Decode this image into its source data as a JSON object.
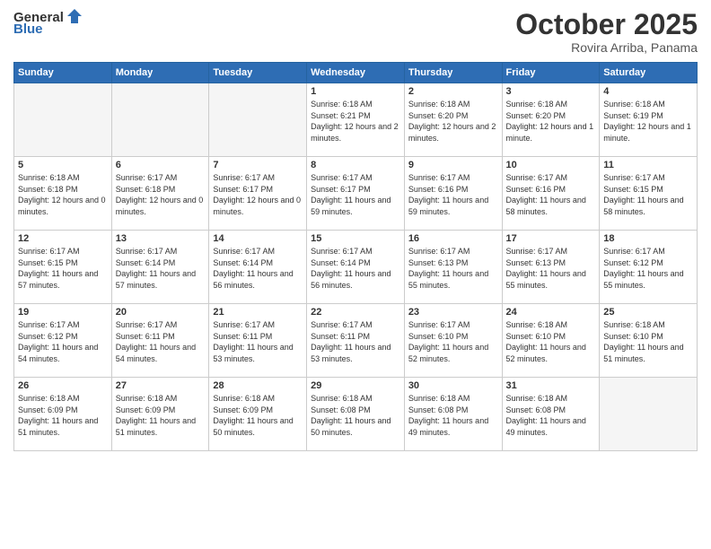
{
  "header": {
    "logo_general": "General",
    "logo_blue": "Blue",
    "month_title": "October 2025",
    "location": "Rovira Arriba, Panama"
  },
  "weekdays": [
    "Sunday",
    "Monday",
    "Tuesday",
    "Wednesday",
    "Thursday",
    "Friday",
    "Saturday"
  ],
  "weeks": [
    [
      {
        "day": "",
        "empty": true
      },
      {
        "day": "",
        "empty": true
      },
      {
        "day": "",
        "empty": true
      },
      {
        "day": "1",
        "sunrise": "Sunrise: 6:18 AM",
        "sunset": "Sunset: 6:21 PM",
        "daylight": "Daylight: 12 hours and 2 minutes."
      },
      {
        "day": "2",
        "sunrise": "Sunrise: 6:18 AM",
        "sunset": "Sunset: 6:20 PM",
        "daylight": "Daylight: 12 hours and 2 minutes."
      },
      {
        "day": "3",
        "sunrise": "Sunrise: 6:18 AM",
        "sunset": "Sunset: 6:20 PM",
        "daylight": "Daylight: 12 hours and 1 minute."
      },
      {
        "day": "4",
        "sunrise": "Sunrise: 6:18 AM",
        "sunset": "Sunset: 6:19 PM",
        "daylight": "Daylight: 12 hours and 1 minute."
      }
    ],
    [
      {
        "day": "5",
        "sunrise": "Sunrise: 6:18 AM",
        "sunset": "Sunset: 6:18 PM",
        "daylight": "Daylight: 12 hours and 0 minutes."
      },
      {
        "day": "6",
        "sunrise": "Sunrise: 6:17 AM",
        "sunset": "Sunset: 6:18 PM",
        "daylight": "Daylight: 12 hours and 0 minutes."
      },
      {
        "day": "7",
        "sunrise": "Sunrise: 6:17 AM",
        "sunset": "Sunset: 6:17 PM",
        "daylight": "Daylight: 12 hours and 0 minutes."
      },
      {
        "day": "8",
        "sunrise": "Sunrise: 6:17 AM",
        "sunset": "Sunset: 6:17 PM",
        "daylight": "Daylight: 11 hours and 59 minutes."
      },
      {
        "day": "9",
        "sunrise": "Sunrise: 6:17 AM",
        "sunset": "Sunset: 6:16 PM",
        "daylight": "Daylight: 11 hours and 59 minutes."
      },
      {
        "day": "10",
        "sunrise": "Sunrise: 6:17 AM",
        "sunset": "Sunset: 6:16 PM",
        "daylight": "Daylight: 11 hours and 58 minutes."
      },
      {
        "day": "11",
        "sunrise": "Sunrise: 6:17 AM",
        "sunset": "Sunset: 6:15 PM",
        "daylight": "Daylight: 11 hours and 58 minutes."
      }
    ],
    [
      {
        "day": "12",
        "sunrise": "Sunrise: 6:17 AM",
        "sunset": "Sunset: 6:15 PM",
        "daylight": "Daylight: 11 hours and 57 minutes."
      },
      {
        "day": "13",
        "sunrise": "Sunrise: 6:17 AM",
        "sunset": "Sunset: 6:14 PM",
        "daylight": "Daylight: 11 hours and 57 minutes."
      },
      {
        "day": "14",
        "sunrise": "Sunrise: 6:17 AM",
        "sunset": "Sunset: 6:14 PM",
        "daylight": "Daylight: 11 hours and 56 minutes."
      },
      {
        "day": "15",
        "sunrise": "Sunrise: 6:17 AM",
        "sunset": "Sunset: 6:14 PM",
        "daylight": "Daylight: 11 hours and 56 minutes."
      },
      {
        "day": "16",
        "sunrise": "Sunrise: 6:17 AM",
        "sunset": "Sunset: 6:13 PM",
        "daylight": "Daylight: 11 hours and 55 minutes."
      },
      {
        "day": "17",
        "sunrise": "Sunrise: 6:17 AM",
        "sunset": "Sunset: 6:13 PM",
        "daylight": "Daylight: 11 hours and 55 minutes."
      },
      {
        "day": "18",
        "sunrise": "Sunrise: 6:17 AM",
        "sunset": "Sunset: 6:12 PM",
        "daylight": "Daylight: 11 hours and 55 minutes."
      }
    ],
    [
      {
        "day": "19",
        "sunrise": "Sunrise: 6:17 AM",
        "sunset": "Sunset: 6:12 PM",
        "daylight": "Daylight: 11 hours and 54 minutes."
      },
      {
        "day": "20",
        "sunrise": "Sunrise: 6:17 AM",
        "sunset": "Sunset: 6:11 PM",
        "daylight": "Daylight: 11 hours and 54 minutes."
      },
      {
        "day": "21",
        "sunrise": "Sunrise: 6:17 AM",
        "sunset": "Sunset: 6:11 PM",
        "daylight": "Daylight: 11 hours and 53 minutes."
      },
      {
        "day": "22",
        "sunrise": "Sunrise: 6:17 AM",
        "sunset": "Sunset: 6:11 PM",
        "daylight": "Daylight: 11 hours and 53 minutes."
      },
      {
        "day": "23",
        "sunrise": "Sunrise: 6:17 AM",
        "sunset": "Sunset: 6:10 PM",
        "daylight": "Daylight: 11 hours and 52 minutes."
      },
      {
        "day": "24",
        "sunrise": "Sunrise: 6:18 AM",
        "sunset": "Sunset: 6:10 PM",
        "daylight": "Daylight: 11 hours and 52 minutes."
      },
      {
        "day": "25",
        "sunrise": "Sunrise: 6:18 AM",
        "sunset": "Sunset: 6:10 PM",
        "daylight": "Daylight: 11 hours and 51 minutes."
      }
    ],
    [
      {
        "day": "26",
        "sunrise": "Sunrise: 6:18 AM",
        "sunset": "Sunset: 6:09 PM",
        "daylight": "Daylight: 11 hours and 51 minutes."
      },
      {
        "day": "27",
        "sunrise": "Sunrise: 6:18 AM",
        "sunset": "Sunset: 6:09 PM",
        "daylight": "Daylight: 11 hours and 51 minutes."
      },
      {
        "day": "28",
        "sunrise": "Sunrise: 6:18 AM",
        "sunset": "Sunset: 6:09 PM",
        "daylight": "Daylight: 11 hours and 50 minutes."
      },
      {
        "day": "29",
        "sunrise": "Sunrise: 6:18 AM",
        "sunset": "Sunset: 6:08 PM",
        "daylight": "Daylight: 11 hours and 50 minutes."
      },
      {
        "day": "30",
        "sunrise": "Sunrise: 6:18 AM",
        "sunset": "Sunset: 6:08 PM",
        "daylight": "Daylight: 11 hours and 49 minutes."
      },
      {
        "day": "31",
        "sunrise": "Sunrise: 6:18 AM",
        "sunset": "Sunset: 6:08 PM",
        "daylight": "Daylight: 11 hours and 49 minutes."
      },
      {
        "day": "",
        "empty": true
      }
    ]
  ]
}
